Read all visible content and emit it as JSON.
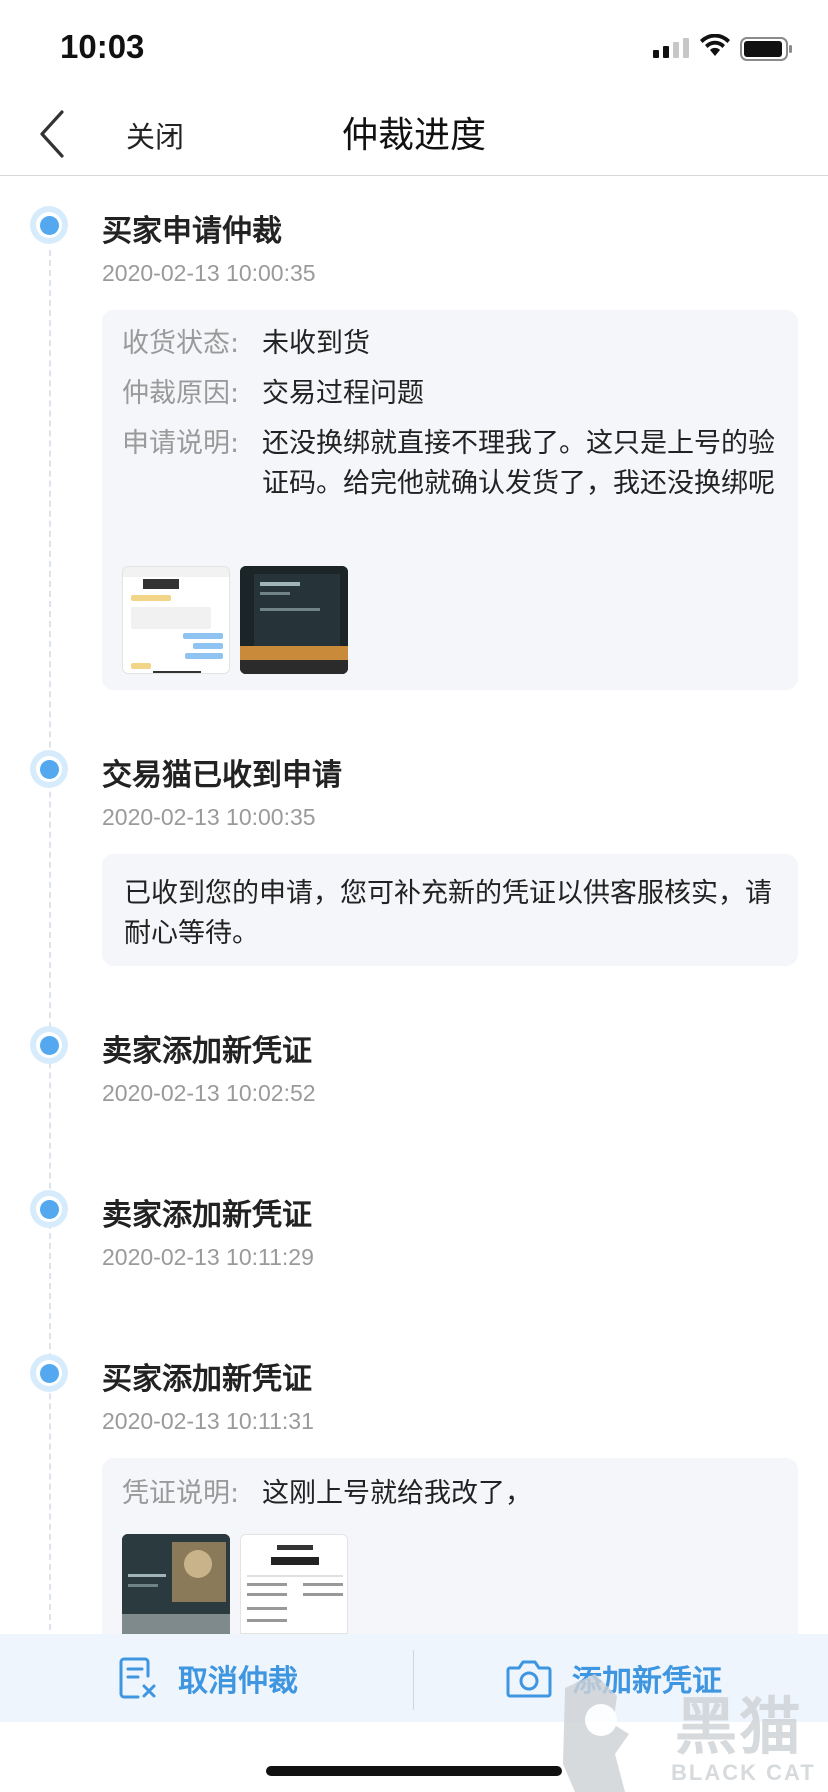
{
  "status_bar": {
    "time": "10:03"
  },
  "nav": {
    "back_icon": "chevron-left-icon",
    "close_label": "关闭",
    "title": "仲裁进度"
  },
  "timeline": [
    {
      "title": "买家申请仲裁",
      "time": "2020-02-13 10:00:35",
      "details": [
        {
          "key": "收货状态:",
          "value": "未收到货"
        },
        {
          "key": "仲裁原因:",
          "value": "交易过程问题"
        },
        {
          "key": "申请说明:",
          "value": "还没换绑就直接不理我了。这只是上号的验证码。给完他就确认发货了，我还没换绑呢"
        }
      ]
    },
    {
      "title": "交易猫已收到申请",
      "time": "2020-02-13 10:00:35",
      "note": "已收到您的申请，您可补充新的凭证以供客服核实，请耐心等待。"
    },
    {
      "title": "卖家添加新凭证",
      "time": "2020-02-13 10:02:52"
    },
    {
      "title": "卖家添加新凭证",
      "time": "2020-02-13 10:11:29"
    },
    {
      "title": "买家添加新凭证",
      "time": "2020-02-13 10:11:31",
      "details": [
        {
          "key": "凭证说明:",
          "value": "这刚上号就给我改了，"
        }
      ]
    }
  ],
  "actions": {
    "cancel_label": "取消仲裁",
    "cancel_icon": "cancel-document-icon",
    "add_label": "添加新凭证",
    "add_icon": "camera-icon"
  },
  "watermark": {
    "cn": "黑猫",
    "en": "BLACK CAT"
  },
  "colors": {
    "accent": "#3e95e0",
    "dot": "#53a8f0",
    "card_bg": "#f4f6f9",
    "muted": "#9a9a9a"
  }
}
